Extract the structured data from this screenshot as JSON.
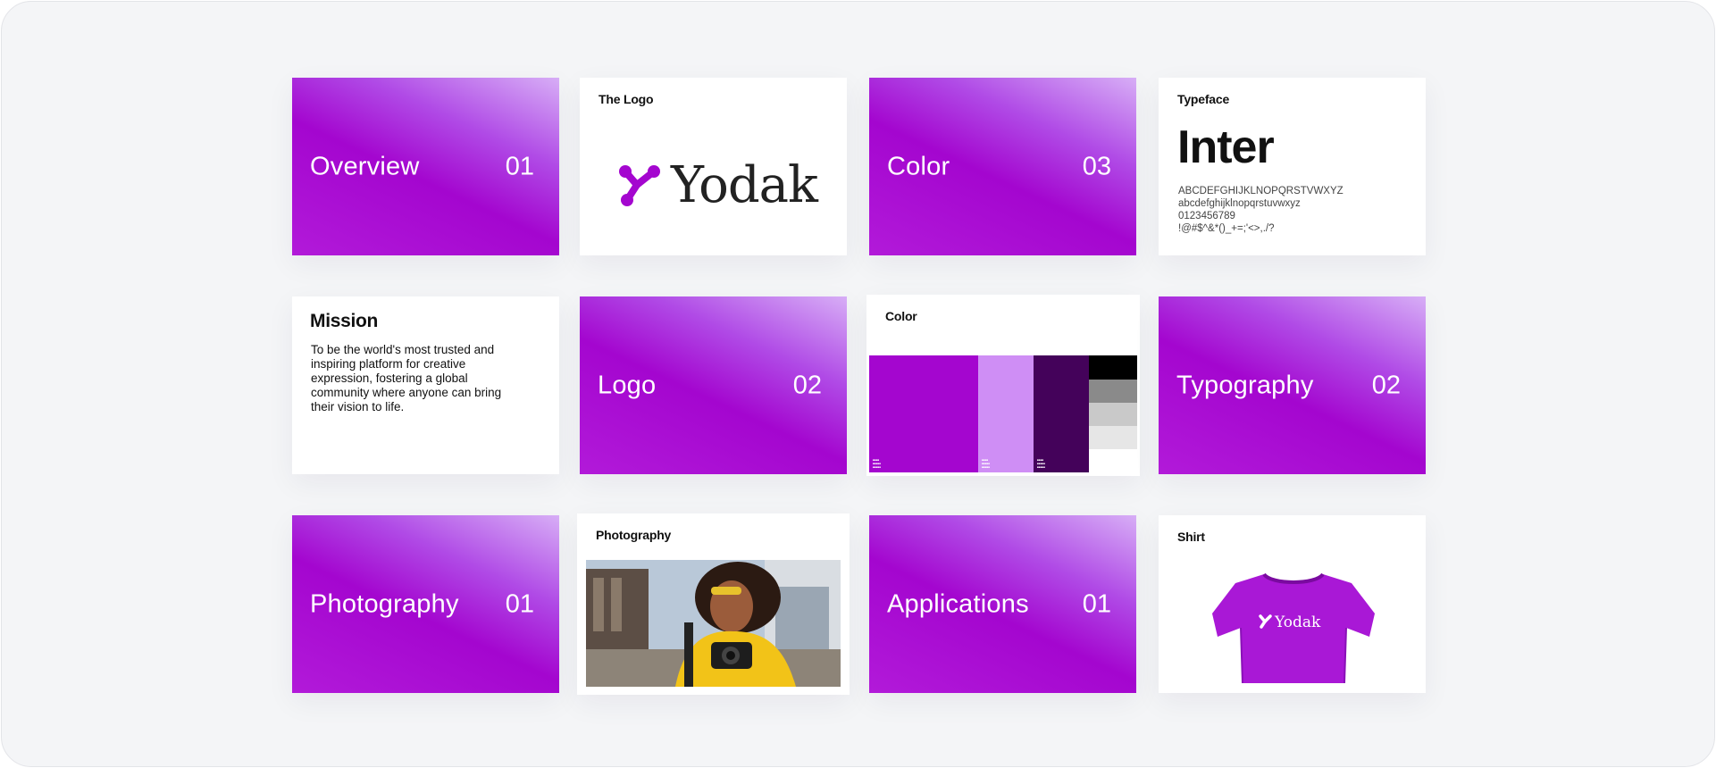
{
  "cards": {
    "overview": {
      "title": "Overview",
      "num": "01"
    },
    "the_logo": {
      "label": "The Logo",
      "wordmark": "Yodak"
    },
    "color_section": {
      "title": "Color",
      "num": "03"
    },
    "typeface": {
      "label": "Typeface",
      "font_name": "Inter",
      "uppercase": "ABCDEFGHIJKLNOPQRSTVWXYZ",
      "lowercase": "abcdefghijklnopqrstuvwxyz",
      "digits": "0123456789",
      "symbols": "!@#$^&*()_+=;'<>,./?"
    },
    "mission": {
      "title": "Mission",
      "text": "To be the world's most trusted and inspiring platform for creative expression, fostering a global community where anyone can bring their vision to life."
    },
    "logo_section": {
      "title": "Logo",
      "num": "02"
    },
    "color_palette": {
      "label": "Color"
    },
    "typography_section": {
      "title": "Typography",
      "num": "02"
    },
    "photography_section": {
      "title": "Photography",
      "num": "01"
    },
    "photography": {
      "label": "Photography"
    },
    "applications_section": {
      "title": "Applications",
      "num": "01"
    },
    "shirt": {
      "label": "Shirt",
      "wordmark": "Yodak"
    }
  },
  "colors": {
    "brand_purple": "#a406cf",
    "light_purple": "#cf8ef5",
    "dark_purple": "#44025a",
    "black": "#000000",
    "gray_dark": "#8a8a8a",
    "gray_mid": "#c9c9c9",
    "gray_light": "#e6e6e6"
  }
}
